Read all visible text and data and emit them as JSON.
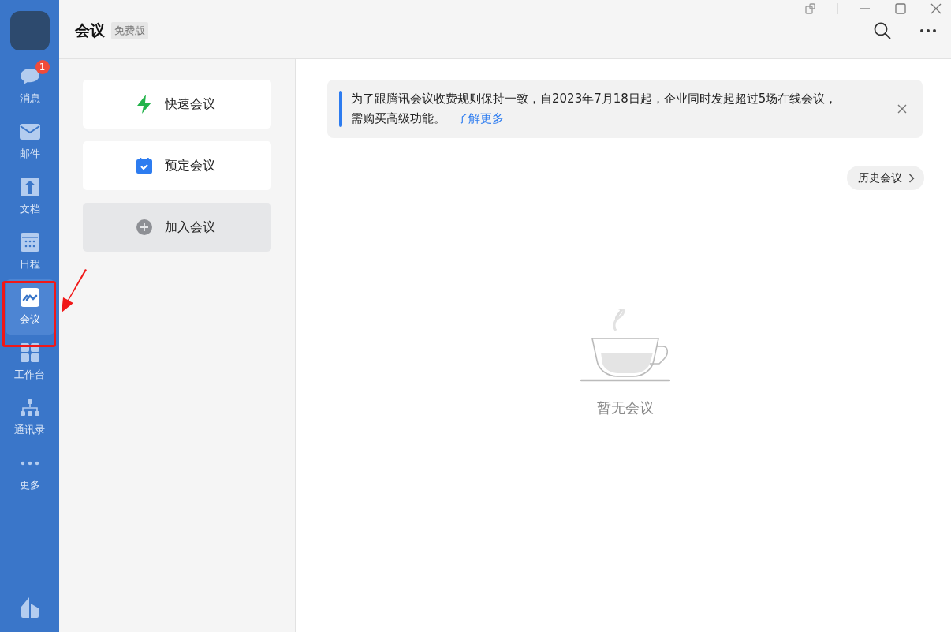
{
  "sidebar": {
    "items": [
      {
        "label": "消息",
        "selected": false,
        "badge": "1"
      },
      {
        "label": "邮件",
        "selected": false
      },
      {
        "label": "文档",
        "selected": false
      },
      {
        "label": "日程",
        "selected": false
      },
      {
        "label": "会议",
        "selected": true
      },
      {
        "label": "工作台",
        "selected": false
      },
      {
        "label": "通讯录",
        "selected": false
      },
      {
        "label": "更多",
        "selected": false
      }
    ]
  },
  "header": {
    "title": "会议",
    "tag": "免费版"
  },
  "actions": [
    {
      "label": "快速会议",
      "kind": "quick"
    },
    {
      "label": "预定会议",
      "kind": "schedule"
    },
    {
      "label": "加入会议",
      "kind": "join"
    }
  ],
  "notice": {
    "text": "为了跟腾讯会议收费规则保持一致，自2023年7月18日起，企业同时发起超过5场在线会议，需购买高级功能。",
    "link": "了解更多"
  },
  "history_button": "历史会议",
  "empty_state": "暂无会议"
}
